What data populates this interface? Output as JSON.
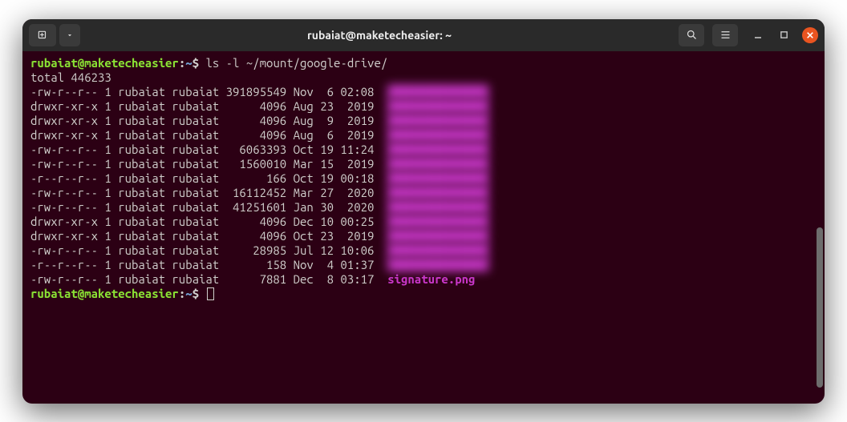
{
  "titlebar": {
    "title": "rubaiat@maketecheasier: ~"
  },
  "prompt": {
    "user_host": "rubaiat@maketecheasier",
    "separator": ":",
    "path": "~",
    "symbol": "$"
  },
  "commands": [
    "ls -l ~/mount/google-drive/"
  ],
  "output": {
    "total_line": "total 446233",
    "rows": [
      {
        "perms": "-rw-r--r--",
        "links": "1",
        "owner": "rubaiat",
        "group": "rubaiat",
        "size": "391895549",
        "month": "Nov",
        "day": " 6",
        "time": "02:08",
        "name": "",
        "blurred": true
      },
      {
        "perms": "drwxr-xr-x",
        "links": "1",
        "owner": "rubaiat",
        "group": "rubaiat",
        "size": "4096",
        "month": "Aug",
        "day": "23",
        "time": " 2019",
        "name": "",
        "blurred": true
      },
      {
        "perms": "drwxr-xr-x",
        "links": "1",
        "owner": "rubaiat",
        "group": "rubaiat",
        "size": "4096",
        "month": "Aug",
        "day": " 9",
        "time": " 2019",
        "name": "",
        "blurred": true
      },
      {
        "perms": "drwxr-xr-x",
        "links": "1",
        "owner": "rubaiat",
        "group": "rubaiat",
        "size": "4096",
        "month": "Aug",
        "day": " 6",
        "time": " 2019",
        "name": "",
        "blurred": true
      },
      {
        "perms": "-rw-r--r--",
        "links": "1",
        "owner": "rubaiat",
        "group": "rubaiat",
        "size": "6063393",
        "month": "Oct",
        "day": "19",
        "time": "11:24",
        "name": "",
        "blurred": true
      },
      {
        "perms": "-rw-r--r--",
        "links": "1",
        "owner": "rubaiat",
        "group": "rubaiat",
        "size": "1560010",
        "month": "Mar",
        "day": "15",
        "time": " 2019",
        "name": "",
        "blurred": true
      },
      {
        "perms": "-r--r--r--",
        "links": "1",
        "owner": "rubaiat",
        "group": "rubaiat",
        "size": "166",
        "month": "Oct",
        "day": "19",
        "time": "00:18",
        "name": "",
        "blurred": true
      },
      {
        "perms": "-rw-r--r--",
        "links": "1",
        "owner": "rubaiat",
        "group": "rubaiat",
        "size": "16112452",
        "month": "Mar",
        "day": "27",
        "time": " 2020",
        "name": "",
        "blurred": true
      },
      {
        "perms": "-rw-r--r--",
        "links": "1",
        "owner": "rubaiat",
        "group": "rubaiat",
        "size": "41251601",
        "month": "Jan",
        "day": "30",
        "time": " 2020",
        "name": "",
        "blurred": true
      },
      {
        "perms": "drwxr-xr-x",
        "links": "1",
        "owner": "rubaiat",
        "group": "rubaiat",
        "size": "4096",
        "month": "Dec",
        "day": "10",
        "time": "00:25",
        "name": "",
        "blurred": true
      },
      {
        "perms": "drwxr-xr-x",
        "links": "1",
        "owner": "rubaiat",
        "group": "rubaiat",
        "size": "4096",
        "month": "Oct",
        "day": "23",
        "time": " 2019",
        "name": "",
        "blurred": true
      },
      {
        "perms": "-rw-r--r--",
        "links": "1",
        "owner": "rubaiat",
        "group": "rubaiat",
        "size": "28985",
        "month": "Jul",
        "day": "12",
        "time": "10:06",
        "name": "",
        "blurred": true
      },
      {
        "perms": "-r--r--r--",
        "links": "1",
        "owner": "rubaiat",
        "group": "rubaiat",
        "size": "158",
        "month": "Nov",
        "day": " 4",
        "time": "01:37",
        "name": "",
        "blurred": true
      },
      {
        "perms": "-rw-r--r--",
        "links": "1",
        "owner": "rubaiat",
        "group": "rubaiat",
        "size": "7881",
        "month": "Dec",
        "day": " 8",
        "time": "03:17",
        "name": "signature.png",
        "blurred": false
      }
    ]
  }
}
